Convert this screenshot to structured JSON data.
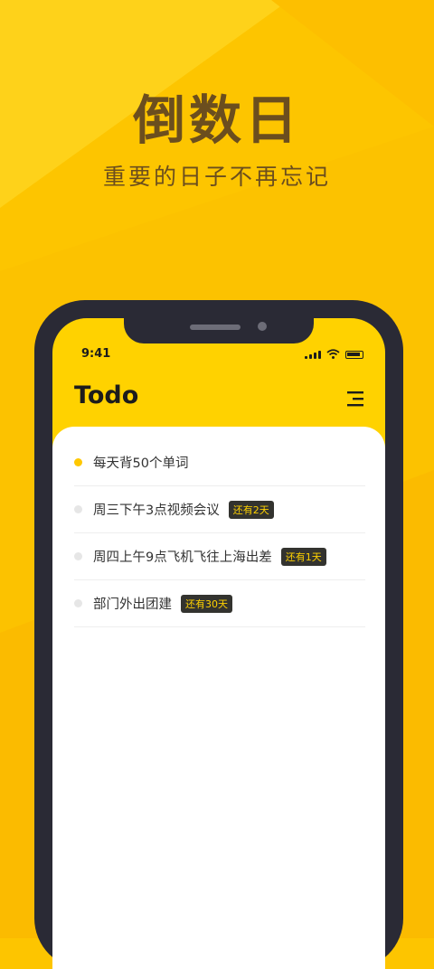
{
  "promo": {
    "headline": "倒数日",
    "subtitle": "重要的日子不再忘记"
  },
  "status_bar": {
    "time": "9:41"
  },
  "app": {
    "title": "Todo",
    "menu_icon": "menu-lines-icon"
  },
  "todos": [
    {
      "text": "每天背50个单词",
      "badge": "",
      "dot_color": "#ffc800"
    },
    {
      "text": "周三下午3点视频会议",
      "badge": "还有2天",
      "dot_color": "#e6e6e6"
    },
    {
      "text": "周四上午9点飞机飞往上海出差",
      "badge": "还有1天",
      "dot_color": "#e6e6e6"
    },
    {
      "text": "部门外出团建",
      "badge": "还有30天",
      "dot_color": "#e6e6e6"
    }
  ],
  "colors": {
    "background": "#fdc500",
    "accent": "#ffd200",
    "promo_text": "#6b4e1e",
    "phone_frame": "#2a2a35",
    "badge_bg": "#33332f"
  }
}
